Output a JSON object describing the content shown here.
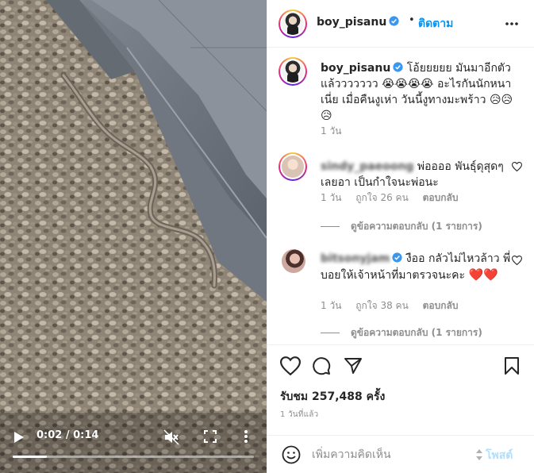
{
  "video": {
    "time": "0:02 / 0:14",
    "progress": 0.14
  },
  "post": {
    "username": "boy_pisanu",
    "follow_label": "ติดตาม",
    "caption_username": "boy_pisanu",
    "caption": "โอ้ยยยยย มันมาอีกตัวแล้ววววววว 😭😭😭😭 อะไรกันนักหนาเนี่ย เมื่อคืนงูเห่า วันนี้งูทางมะพร้าว 😥😥😥",
    "caption_age": "1 วัน"
  },
  "comments": [
    {
      "username": "sindy_paeoong",
      "text": "พ่ออออ พันธุ์ดุสุดๆเลยอา เป็นกำใจนะพ่อนะ",
      "age": "1 วัน",
      "likes": "ถูกใจ 26 คน",
      "reply_label": "ตอบกลับ",
      "view_replies": "ดูข้อความตอบกลับ (1 รายการ)"
    },
    {
      "username": "bitsonyjam",
      "text": "งืออ กลัวไม่ไหวล้าว พี่บอยให้เจ้าหน้าที่มาตรวจนะคะ",
      "emojis": "❤️❤️",
      "age": "1 วัน",
      "likes": "ถูกใจ 38 คน",
      "reply_label": "ตอบกลับ",
      "view_replies": "ดูข้อความตอบกลับ (1 รายการ)"
    }
  ],
  "stats": {
    "views": "รับชม 257,488 ครั้ง",
    "posted": "1 วันที่แล้ว"
  },
  "composer": {
    "placeholder": "เพิ่มความคิดเห็น",
    "post_label": "โพสต์"
  },
  "icons": {
    "like": "heart-icon",
    "comment": "comment-icon",
    "share": "share-icon",
    "save": "bookmark-icon",
    "emoji": "emoji-icon",
    "verified": "verified-icon",
    "more": "more-icon"
  },
  "colors": {
    "link": "#0095f6",
    "verified": "#3897f0",
    "post_disabled": "#b2dffc",
    "heart": "#e0245e"
  }
}
